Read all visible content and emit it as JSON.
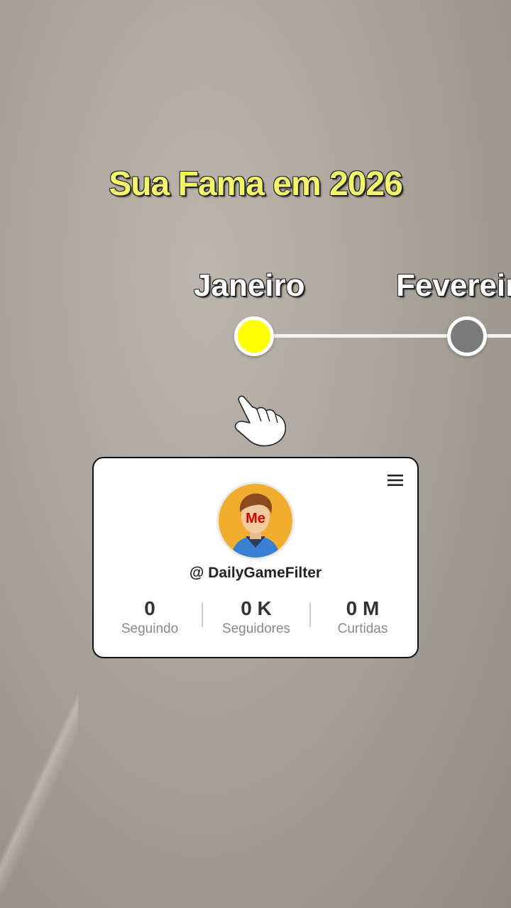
{
  "title": "Sua Fama em 2026",
  "timeline": {
    "months": [
      "Janeiro",
      "Fevereiro"
    ],
    "active_month": "Janeiro"
  },
  "profile": {
    "avatar_label": "Me",
    "handle": "@ DailyGameFilter",
    "stats": [
      {
        "value": "0",
        "label": "Seguindo"
      },
      {
        "value": "0 K",
        "label": "Seguidores"
      },
      {
        "value": "0 M",
        "label": "Curtidas"
      }
    ]
  },
  "colors": {
    "title": "#f4f56a",
    "active_node": "#ffff00",
    "inactive_node": "#7a7a7a"
  }
}
